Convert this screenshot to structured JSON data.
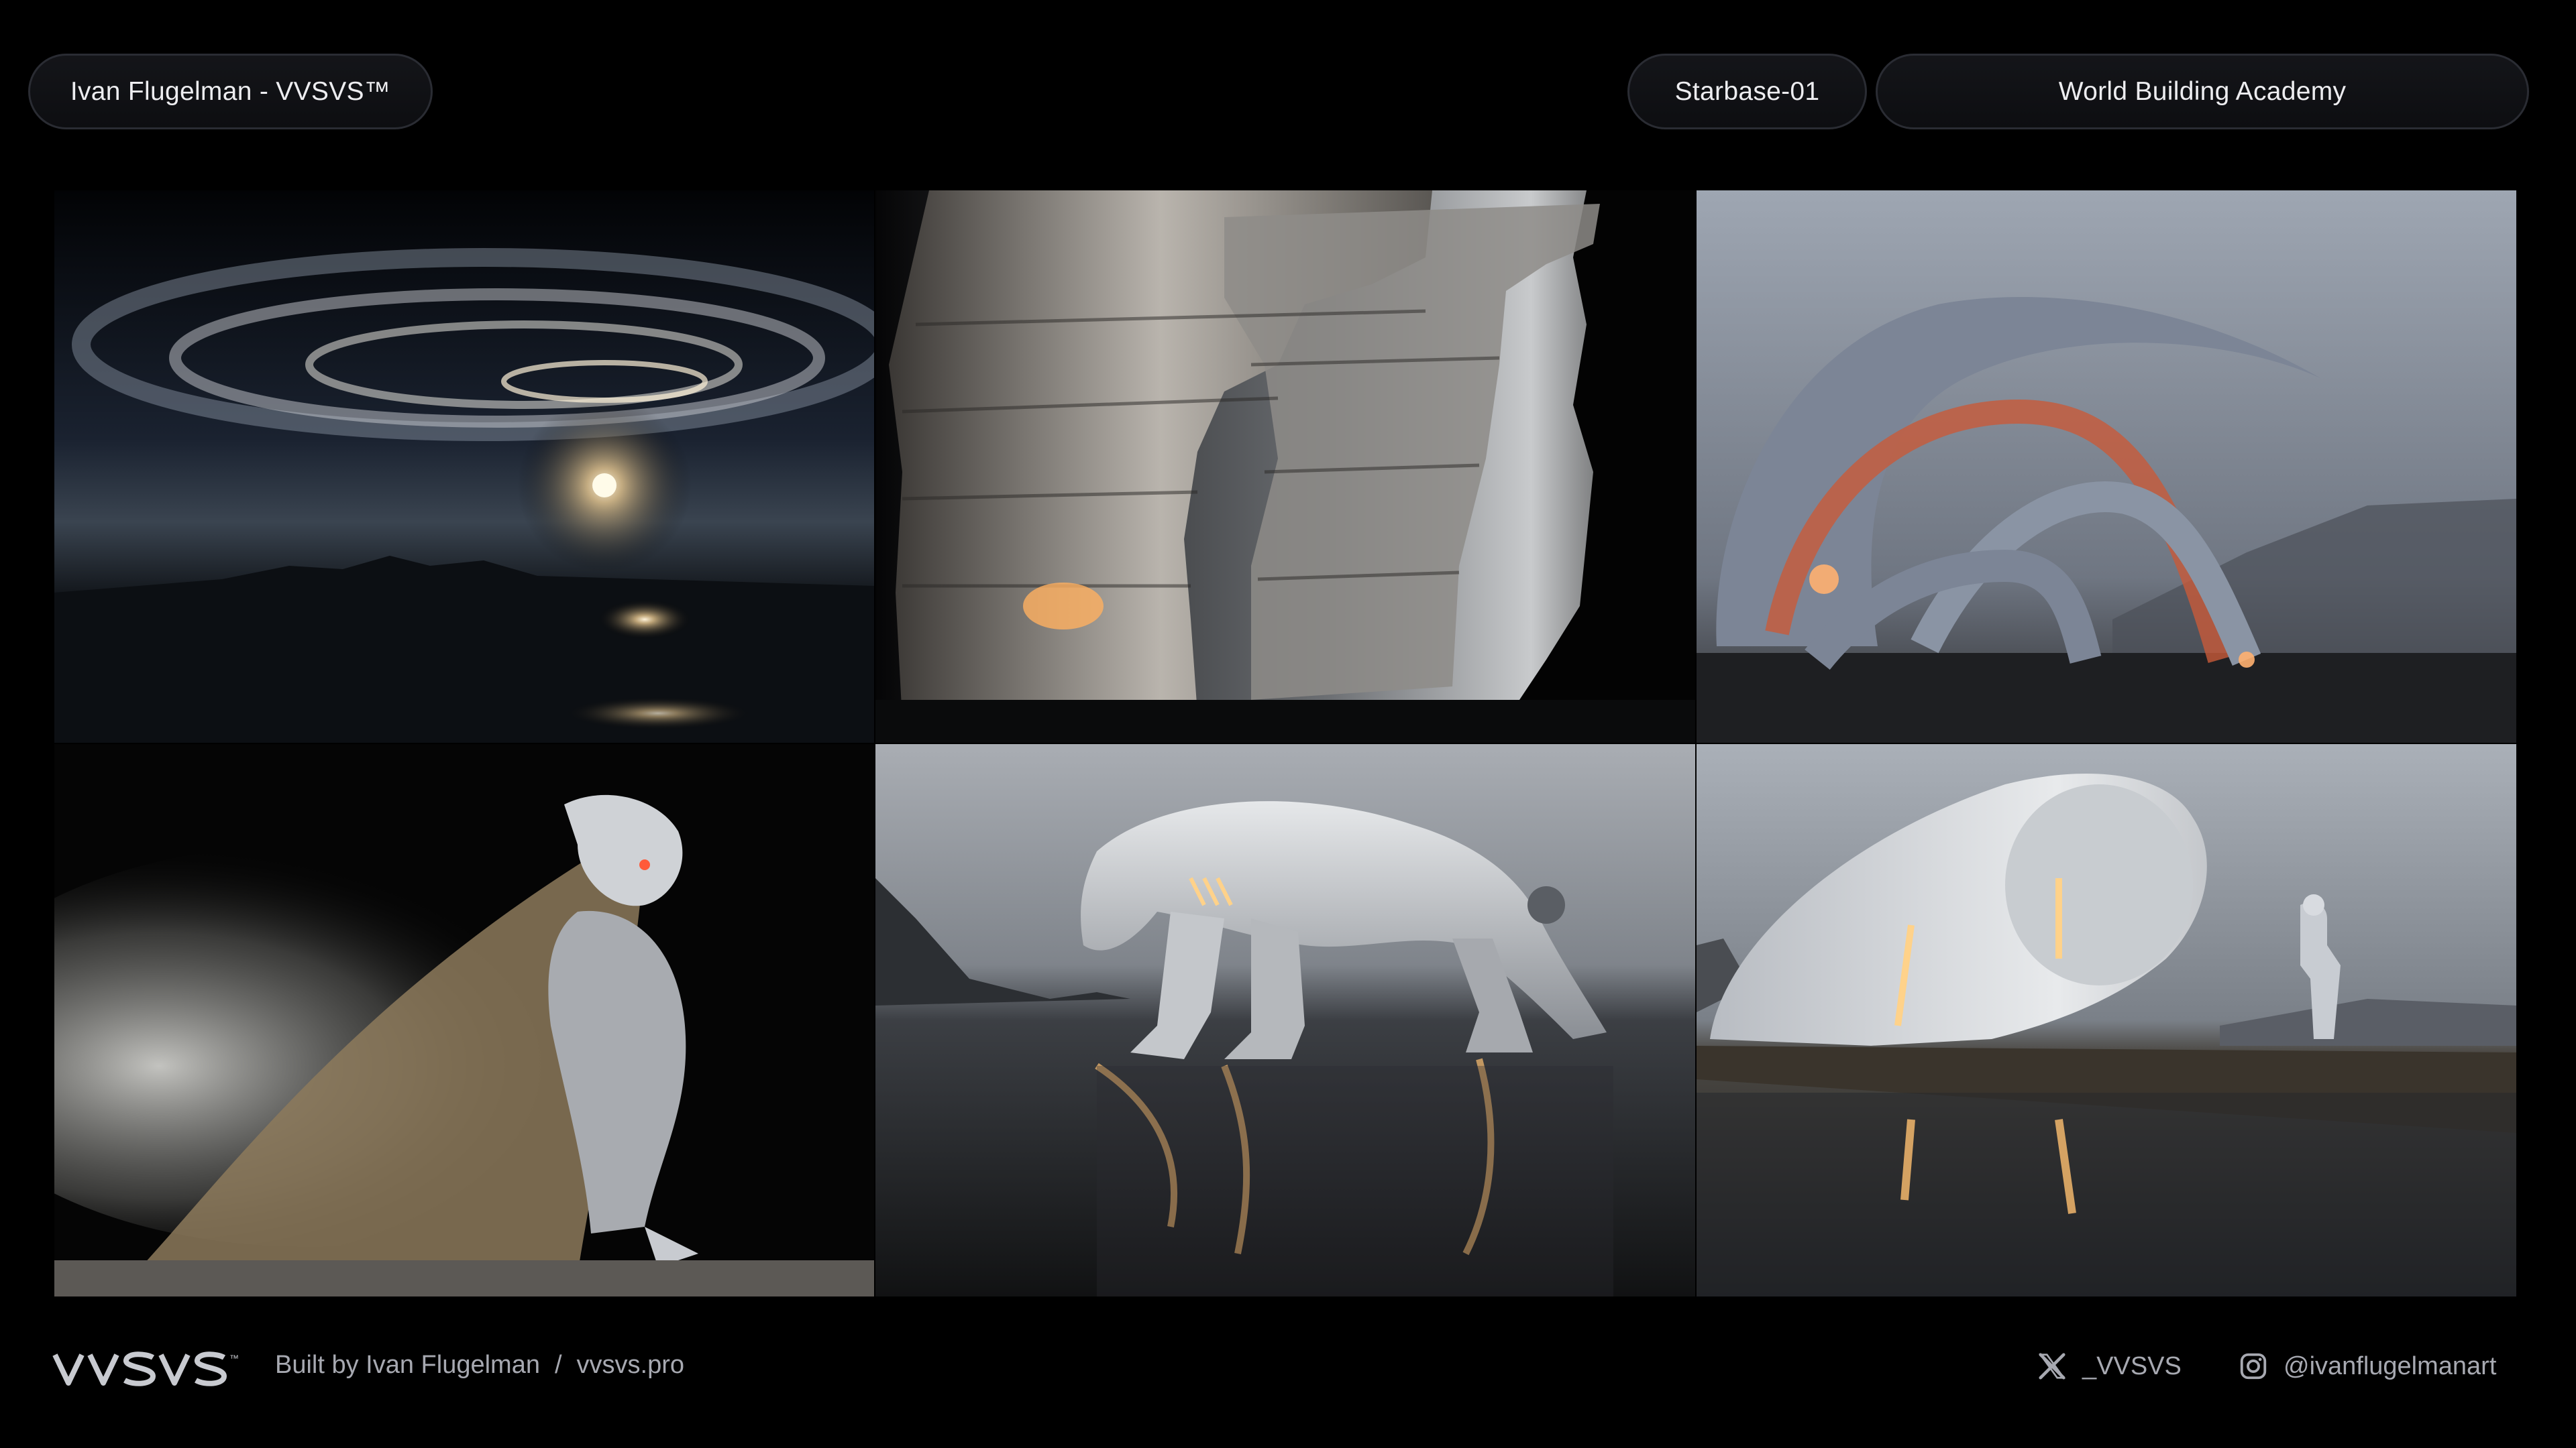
{
  "header": {
    "author_pill": "Ivan Flugelman - VVSVS™",
    "project_pill": "Starbase-01",
    "academy_pill": "World Building Academy"
  },
  "gallery": {
    "tiles": [
      {
        "icon": "galaxy-sunrise-image"
      },
      {
        "icon": "rock-spires-image"
      },
      {
        "icon": "tentacle-creature-image"
      },
      {
        "icon": "cloaked-astronaut-image"
      },
      {
        "icon": "robot-panther-image"
      },
      {
        "icon": "robot-beast-and-astronaut-image"
      }
    ]
  },
  "footer": {
    "logo_text": "VVSVS",
    "logo_tm": "™",
    "built_by": "Built by Ivan Flugelman",
    "separator": "/",
    "site": "vvsvs.pro",
    "x_handle": "_VVSVS",
    "instagram_handle": "@ivanflugelmanart"
  },
  "colors": {
    "background": "#000000",
    "pill_border": "#2a2c33",
    "text_primary": "#ededf0",
    "text_secondary": "#a7a9b1"
  }
}
